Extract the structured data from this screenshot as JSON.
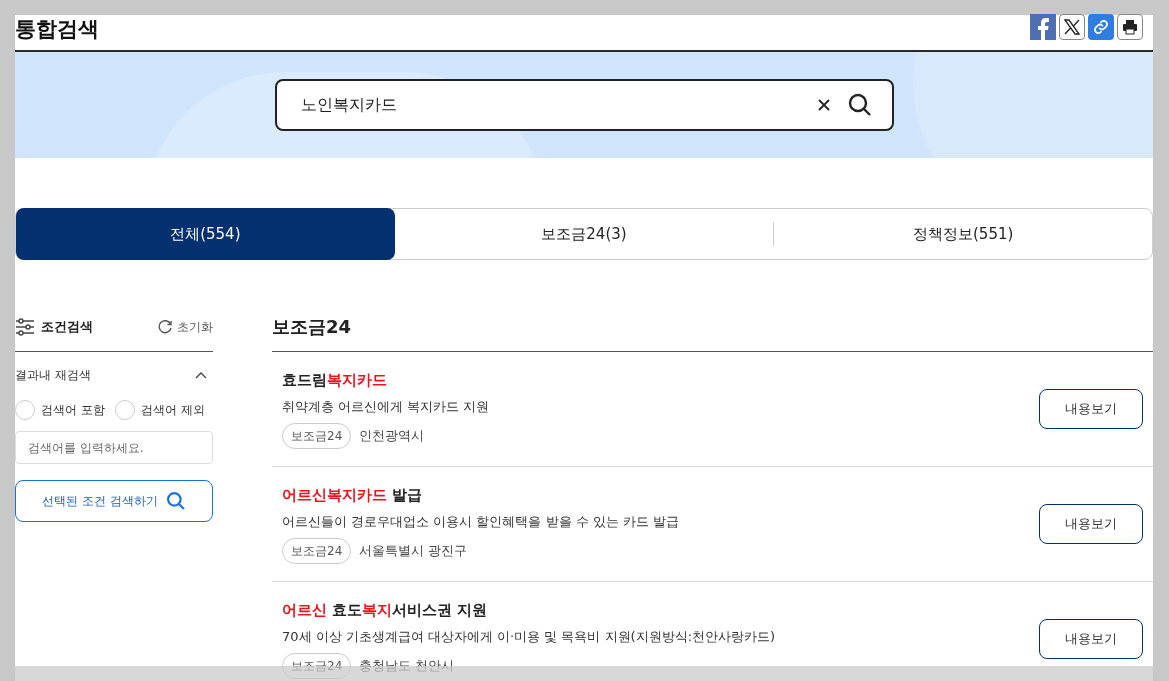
{
  "header": {
    "title": "통합검색",
    "share": [
      {
        "kind": "facebook"
      },
      {
        "kind": "x"
      },
      {
        "kind": "link"
      },
      {
        "kind": "print"
      }
    ]
  },
  "search": {
    "value": "노인복지카드"
  },
  "tabs": [
    {
      "label": "전체(554)",
      "selected": true
    },
    {
      "label": "보조금24(3)",
      "selected": false
    },
    {
      "label": "정책정보(551)",
      "selected": false
    }
  ],
  "sidebar": {
    "title": "조건검색",
    "reset": "초기화",
    "section": {
      "title": "결과내 재검색",
      "expanded": true,
      "options": [
        {
          "label": "검색어 포함",
          "selected": false
        },
        {
          "label": "검색어 제외",
          "selected": false
        }
      ],
      "placeholder": "검색어를 입력하세요.",
      "button": "선택된 조건 검색하기"
    }
  },
  "results": {
    "heading": "보조금24",
    "items": [
      {
        "title": [
          {
            "text": "효드림",
            "highlight": false
          },
          {
            "text": "복지카드",
            "highlight": true
          }
        ],
        "description": "취약계층 어르신에게 복지카드 지원",
        "tag": "보조금24",
        "region": "인천광역시",
        "button": "내용보기"
      },
      {
        "title": [
          {
            "text": "어르신복지카드",
            "highlight": true
          },
          {
            "text": " 발급",
            "highlight": false
          }
        ],
        "description": "어르신들이 경로우대업소 이용시 할인혜택을 받을 수 있는 카드 발급",
        "tag": "보조금24",
        "region": "서울특별시 광진구",
        "button": "내용보기"
      },
      {
        "title": [
          {
            "text": "어르신",
            "highlight": true
          },
          {
            "text": " 효도",
            "highlight": false
          },
          {
            "text": "복지",
            "highlight": true
          },
          {
            "text": "서비스권 지원",
            "highlight": false
          }
        ],
        "description": "70세 이상 기초생계급여 대상자에게 이·미용 및 목욕비 지원(지원방식:천안사랑카드)",
        "tag": "보조금24",
        "region": "충청남도 천안시",
        "button": "내용보기"
      }
    ]
  }
}
